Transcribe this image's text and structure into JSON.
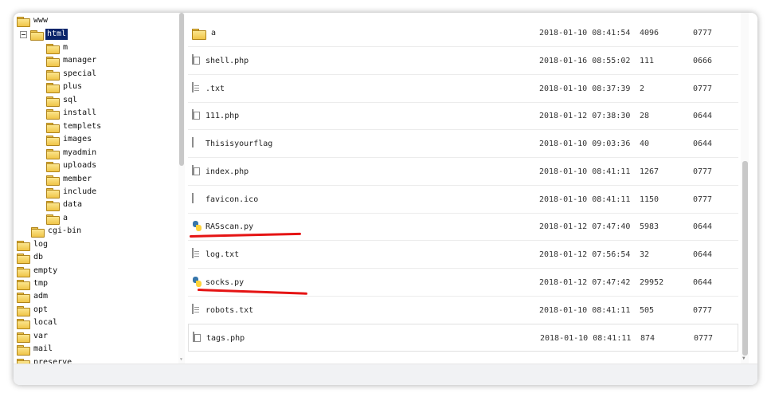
{
  "tree": {
    "items": [
      {
        "label": "www",
        "level": 0
      },
      {
        "label": "html",
        "level": 1,
        "expanded": true,
        "selected": true
      },
      {
        "label": "m",
        "level": 2
      },
      {
        "label": "manager",
        "level": 2
      },
      {
        "label": "special",
        "level": 2
      },
      {
        "label": "plus",
        "level": 2
      },
      {
        "label": "sql",
        "level": 2
      },
      {
        "label": "install",
        "level": 2
      },
      {
        "label": "templets",
        "level": 2
      },
      {
        "label": "images",
        "level": 2
      },
      {
        "label": "myadmin",
        "level": 2
      },
      {
        "label": "uploads",
        "level": 2
      },
      {
        "label": "member",
        "level": 2
      },
      {
        "label": "include",
        "level": 2
      },
      {
        "label": "data",
        "level": 2
      },
      {
        "label": "a",
        "level": 2
      },
      {
        "label": "cgi-bin",
        "level": 1
      },
      {
        "label": "log",
        "level": 0
      },
      {
        "label": "db",
        "level": 0
      },
      {
        "label": "empty",
        "level": 0
      },
      {
        "label": "tmp",
        "level": 0
      },
      {
        "label": "adm",
        "level": 0
      },
      {
        "label": "opt",
        "level": 0
      },
      {
        "label": "local",
        "level": 0
      },
      {
        "label": "var",
        "level": 0
      },
      {
        "label": "mail",
        "level": 0
      },
      {
        "label": "preserve",
        "level": 0
      }
    ]
  },
  "files": [
    {
      "name": "a",
      "icon": "folder-icon",
      "modified": "2018-01-10 08:41:54",
      "size": "4096",
      "perm": "0777"
    },
    {
      "name": "shell.php",
      "icon": "php-file-icon",
      "modified": "2018-01-16 08:55:02",
      "size": "111",
      "perm": "0666"
    },
    {
      "name": ".txt",
      "icon": "text-file-icon",
      "modified": "2018-01-10 08:37:39",
      "size": "2",
      "perm": "0777"
    },
    {
      "name": "111.php",
      "icon": "php-file-icon",
      "modified": "2018-01-12 07:38:30",
      "size": "28",
      "perm": "0644"
    },
    {
      "name": "Thisisyourflag",
      "icon": "blank-file-icon",
      "modified": "2018-01-10 09:03:36",
      "size": "40",
      "perm": "0644"
    },
    {
      "name": "index.php",
      "icon": "php-file-icon",
      "modified": "2018-01-10 08:41:11",
      "size": "1267",
      "perm": "0777"
    },
    {
      "name": "favicon.ico",
      "icon": "blank-file-icon",
      "modified": "2018-01-10 08:41:11",
      "size": "1150",
      "perm": "0777"
    },
    {
      "name": "RASscan.py",
      "icon": "python-file-icon",
      "modified": "2018-01-12 07:47:40",
      "size": "5983",
      "perm": "0644",
      "highlighted": true
    },
    {
      "name": "log.txt",
      "icon": "text-file-icon",
      "modified": "2018-01-12 07:56:54",
      "size": "32",
      "perm": "0644"
    },
    {
      "name": "socks.py",
      "icon": "python-file-icon",
      "modified": "2018-01-12 07:47:42",
      "size": "29952",
      "perm": "0644",
      "highlighted": true
    },
    {
      "name": "robots.txt",
      "icon": "text-file-icon",
      "modified": "2018-01-10 08:41:11",
      "size": "505",
      "perm": "0777"
    },
    {
      "name": "tags.php",
      "icon": "php-file-icon",
      "modified": "2018-01-10 08:41:11",
      "size": "874",
      "perm": "0777"
    }
  ],
  "colors": {
    "selection": "#0a246a",
    "annotation": "#e51414",
    "folder": "#f0c548"
  }
}
